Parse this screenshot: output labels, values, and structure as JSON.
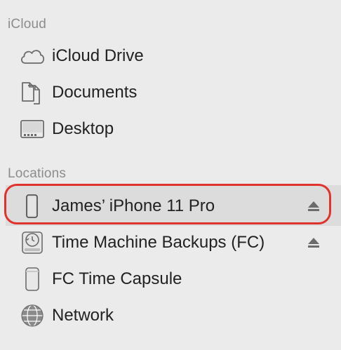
{
  "sections": [
    {
      "header": "iCloud",
      "items": [
        {
          "label": "iCloud Drive",
          "icon": "cloud-icon"
        },
        {
          "label": "Documents",
          "icon": "documents-icon"
        },
        {
          "label": "Desktop",
          "icon": "desktop-icon"
        }
      ]
    },
    {
      "header": "Locations",
      "items": [
        {
          "label": "James’ iPhone 11 Pro",
          "icon": "iphone-icon",
          "eject": true,
          "selected": true,
          "annotated": true
        },
        {
          "label": "Time Machine Backups (FC)",
          "icon": "time-machine-disk-icon",
          "eject": true
        },
        {
          "label": "FC Time Capsule",
          "icon": "time-capsule-icon"
        },
        {
          "label": "Network",
          "icon": "network-globe-icon"
        }
      ]
    }
  ],
  "colors": {
    "sidebar_bg": "#ebebeb",
    "selected_bg": "#dcdcdc",
    "annotation_ring": "#e0332d",
    "header_text": "#8c8c8c",
    "item_text": "#222222"
  }
}
